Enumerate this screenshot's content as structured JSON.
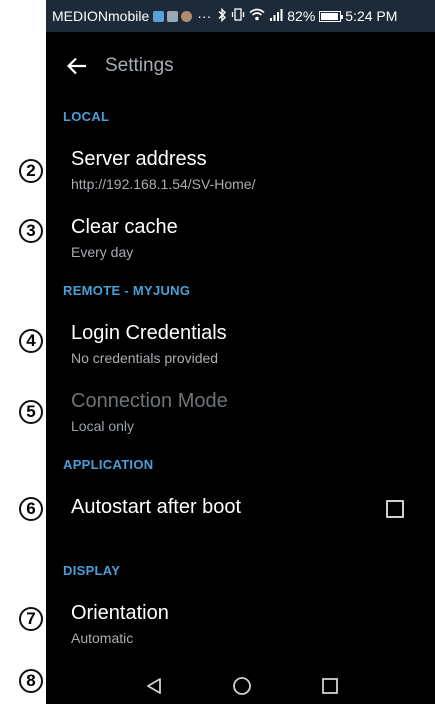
{
  "callouts": [
    "2",
    "3",
    "4",
    "5",
    "6",
    "7",
    "8"
  ],
  "status_bar": {
    "carrier": "MEDIONmobile",
    "dots": "···",
    "bluetooth_icon": "bluetooth-icon",
    "vibrate_icon": "vibrate-icon",
    "wifi_icon": "wifi-icon",
    "signal_icon": "signal-icon",
    "battery_percent": "82%",
    "battery_level": 0.82,
    "time": "5:24 PM"
  },
  "toolbar": {
    "title": "Settings",
    "back_icon": "back-arrow-icon"
  },
  "sections": {
    "local": "LOCAL",
    "remote": "REMOTE - MYJUNG",
    "application": "APPLICATION",
    "display": "DISPLAY"
  },
  "items": {
    "server_address": {
      "title": "Server address",
      "summary": "http://192.168.1.54/SV-Home/"
    },
    "clear_cache": {
      "title": "Clear cache",
      "summary": "Every day"
    },
    "login_credentials": {
      "title": "Login Credentials",
      "summary": "No credentials provided"
    },
    "connection_mode": {
      "title": "Connection Mode",
      "summary": "Local only",
      "enabled": false
    },
    "autostart": {
      "title": "Autostart after boot",
      "checked": false
    },
    "orientation": {
      "title": "Orientation",
      "summary": "Automatic"
    }
  },
  "nav_bar": {
    "back": "nav-back-icon",
    "home": "nav-home-icon",
    "recents": "nav-recents-icon"
  },
  "colors": {
    "accent": "#4a9fd8",
    "background": "#000000",
    "status_bar": "#1e2a3a",
    "secondary_text": "#a8adb3"
  }
}
